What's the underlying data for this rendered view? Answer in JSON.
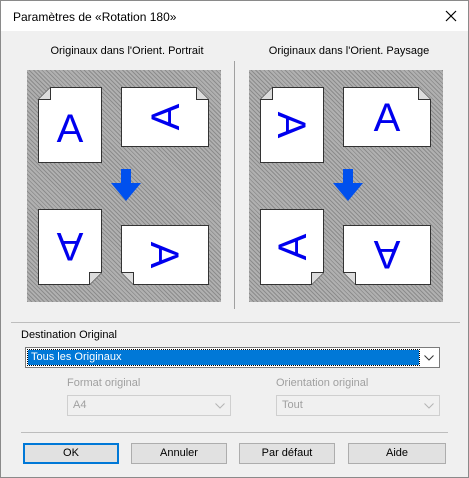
{
  "window": {
    "title": "Paramètres de «Rotation 180»"
  },
  "preview": {
    "portrait_caption": "Originaux dans l'Orient. Portrait",
    "landscape_caption": "Originaux dans l'Orient. Paysage",
    "glyph": "A",
    "glyph_color": "#0000ee",
    "arrow_color": "#0050ee"
  },
  "destination": {
    "label": "Destination Original",
    "value": "Tous les Originaux"
  },
  "format": {
    "label": "Format original",
    "value": "A4",
    "enabled": false
  },
  "orientation": {
    "label": "Orientation original",
    "value": "Tout",
    "enabled": false
  },
  "buttons": {
    "ok": "OK",
    "cancel": "Annuler",
    "default": "Par défaut",
    "help": "Aide"
  },
  "icons": {
    "close": "close-icon",
    "dropdown": "chevron-down-icon",
    "flow": "arrow-down-icon"
  }
}
